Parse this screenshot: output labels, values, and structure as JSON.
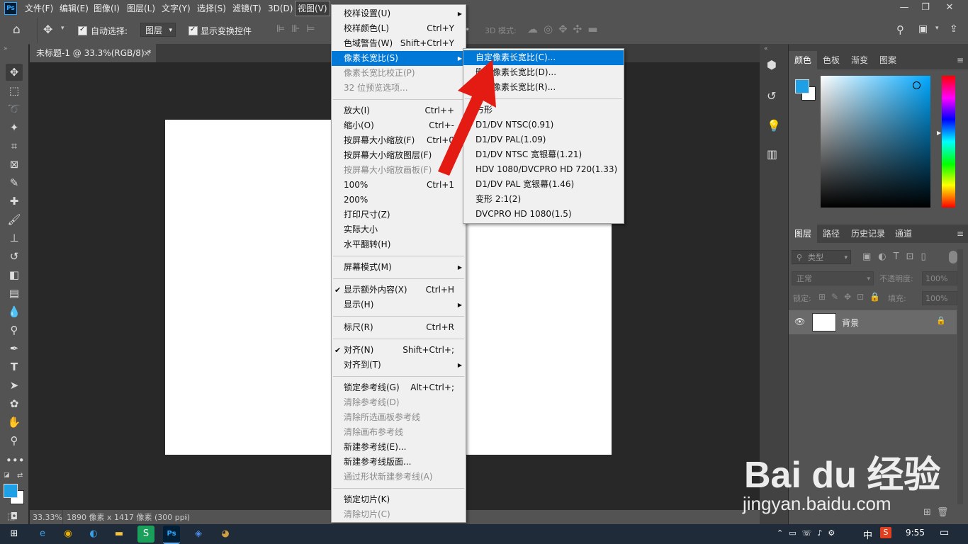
{
  "menubar": {
    "logo": "Ps",
    "items": [
      "文件(F)",
      "编辑(E)",
      "图像(I)",
      "图层(L)",
      "文字(Y)",
      "选择(S)",
      "滤镜(T)",
      "3D(D)",
      "视图(V)"
    ]
  },
  "options": {
    "auto_select_label": "自动选择:",
    "auto_select_value": "图层",
    "show_transform_label": "显示变换控件",
    "mode_3d_label": "3D 模式:"
  },
  "document": {
    "tab_title": "未标题-1 @ 33.3%(RGB/8) *",
    "close": "×"
  },
  "status": {
    "zoom": "33.33%",
    "info": "1890 像素 x 1417 像素 (300 ppi)"
  },
  "view_menu": [
    {
      "label": "校样设置(U)",
      "shortcut": "",
      "submenu": true
    },
    {
      "label": "校样颜色(L)",
      "shortcut": "Ctrl+Y"
    },
    {
      "label": "色域警告(W)",
      "shortcut": "Shift+Ctrl+Y"
    },
    {
      "label": "像素长宽比(S)",
      "shortcut": "",
      "submenu": true,
      "highlight": true
    },
    {
      "label": "像素长宽比校正(P)",
      "shortcut": "",
      "disabled": true
    },
    {
      "label": "32 位预览选项...",
      "shortcut": "",
      "disabled": true
    },
    {
      "label": "放大(I)",
      "shortcut": "Ctrl++"
    },
    {
      "label": "缩小(O)",
      "shortcut": "Ctrl+-"
    },
    {
      "label": "按屏幕大小缩放(F)",
      "shortcut": "Ctrl+0"
    },
    {
      "label": "按屏幕大小缩放图层(F)",
      "shortcut": ""
    },
    {
      "label": "按屏幕大小缩放画板(F)",
      "shortcut": "",
      "disabled": true
    },
    {
      "label": "100%",
      "shortcut": "Ctrl+1"
    },
    {
      "label": "200%",
      "shortcut": ""
    },
    {
      "label": "打印尺寸(Z)",
      "shortcut": ""
    },
    {
      "label": "实际大小",
      "shortcut": ""
    },
    {
      "label": "水平翻转(H)",
      "shortcut": ""
    },
    {
      "label": "屏幕模式(M)",
      "shortcut": "",
      "submenu": true
    },
    {
      "label": "显示额外内容(X)",
      "shortcut": "Ctrl+H",
      "checked": true
    },
    {
      "label": "显示(H)",
      "shortcut": "",
      "submenu": true
    },
    {
      "label": "标尺(R)",
      "shortcut": "Ctrl+R"
    },
    {
      "label": "对齐(N)",
      "shortcut": "Shift+Ctrl+;",
      "checked": true
    },
    {
      "label": "对齐到(T)",
      "shortcut": "",
      "submenu": true
    },
    {
      "label": "锁定参考线(G)",
      "shortcut": "Alt+Ctrl+;"
    },
    {
      "label": "清除参考线(D)",
      "shortcut": "",
      "disabled": true
    },
    {
      "label": "清除所选画板参考线",
      "shortcut": "",
      "disabled": true
    },
    {
      "label": "清除画布参考线",
      "shortcut": "",
      "disabled": true
    },
    {
      "label": "新建参考线(E)...",
      "shortcut": ""
    },
    {
      "label": "新建参考线版面...",
      "shortcut": ""
    },
    {
      "label": "通过形状新建参考线(A)",
      "shortcut": "",
      "disabled": true
    },
    {
      "label": "锁定切片(K)",
      "shortcut": ""
    },
    {
      "label": "清除切片(C)",
      "shortcut": "",
      "disabled": true
    }
  ],
  "aspect_submenu": [
    {
      "label": "自定像素长宽比(C)...",
      "highlight": true
    },
    {
      "label": "删除像素长宽比(D)..."
    },
    {
      "label": "复位像素长宽比(R)..."
    },
    {
      "label": "方形",
      "checked": true
    },
    {
      "label": "D1/DV NTSC(0.91)"
    },
    {
      "label": "D1/DV PAL(1.09)"
    },
    {
      "label": "D1/DV NTSC 宽银幕(1.21)"
    },
    {
      "label": "HDV 1080/DVCPRO HD 720(1.33)"
    },
    {
      "label": "D1/DV PAL 宽银幕(1.46)"
    },
    {
      "label": "变形 2:1(2)"
    },
    {
      "label": "DVCPRO HD 1080(1.5)"
    }
  ],
  "color_panel": {
    "tabs": [
      "颜色",
      "色板",
      "渐变",
      "图案"
    ],
    "foreground": "#1ea0e6",
    "background": "#ffffff"
  },
  "layers_panel": {
    "tabs": [
      "图层",
      "路径",
      "历史记录",
      "通道"
    ],
    "filter_placeholder": "类型",
    "blend_mode": "正常",
    "opacity_label": "不透明度:",
    "opacity_value": "100%",
    "lock_label": "锁定:",
    "fill_label": "填充:",
    "fill_value": "100%",
    "layer_name": "背景"
  },
  "watermark": {
    "logo_text": "Bai du 经验",
    "url": "jingyan.baidu.com"
  },
  "taskbar": {
    "ime": "中",
    "time": "9:55"
  }
}
